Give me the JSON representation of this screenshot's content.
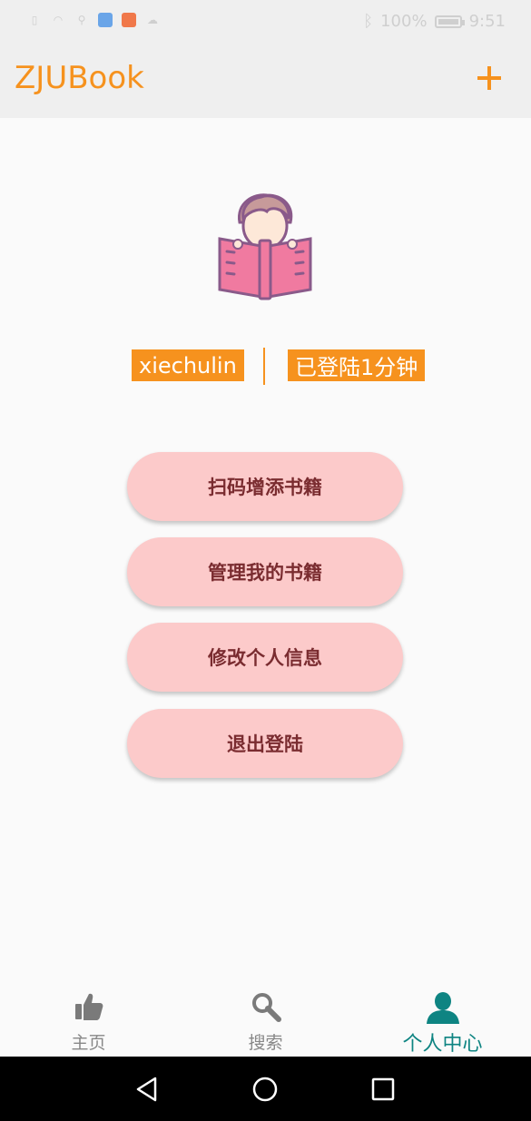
{
  "status_bar": {
    "battery": "100%",
    "time": "9:51"
  },
  "app_bar": {
    "title": "ZJUBook",
    "add_icon": "plus-icon"
  },
  "profile": {
    "username": "xiechulin",
    "login_status": "已登陆1分钟"
  },
  "menu": {
    "items": [
      {
        "label": "扫码增添书籍"
      },
      {
        "label": "管理我的书籍"
      },
      {
        "label": "修改个人信息"
      },
      {
        "label": "退出登陆"
      }
    ]
  },
  "bottom_nav": {
    "items": [
      {
        "label": "主页",
        "icon": "thumbs-up-icon"
      },
      {
        "label": "搜索",
        "icon": "search-icon"
      },
      {
        "label": "个人中心",
        "icon": "person-icon"
      }
    ],
    "active_index": 2
  },
  "colors": {
    "accent": "#f6921e",
    "button_bg": "#fccaca",
    "button_text": "#7a2c30",
    "active_nav": "#0e8482"
  }
}
